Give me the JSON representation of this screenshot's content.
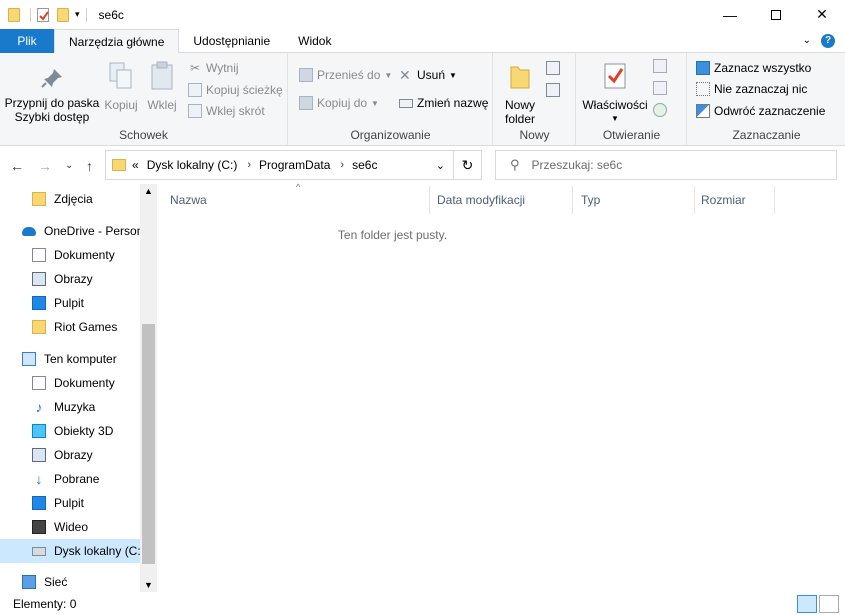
{
  "window": {
    "title": "se6c"
  },
  "tabs": {
    "file": "Plik",
    "home": "Narzędzia główne",
    "share": "Udostępnianie",
    "view": "Widok"
  },
  "ribbon": {
    "clipboard": {
      "label": "Schowek",
      "pin": "Przypnij do paska Szybki dostęp",
      "copy": "Kopiuj",
      "paste": "Wklej",
      "cut": "Wytnij",
      "copy_path": "Kopiuj ścieżkę",
      "paste_shortcut": "Wklej skrót"
    },
    "organize": {
      "label": "Organizowanie",
      "move_to": "Przenieś do",
      "copy_to": "Kopiuj do",
      "delete": "Usuń",
      "rename": "Zmień nazwę"
    },
    "new": {
      "label": "Nowy",
      "new_folder": "Nowy folder"
    },
    "open": {
      "label": "Otwieranie",
      "properties": "Właściwości"
    },
    "select": {
      "label": "Zaznaczanie",
      "select_all": "Zaznacz wszystko",
      "select_none": "Nie zaznaczaj nic",
      "invert": "Odwróć zaznaczenie"
    }
  },
  "address": {
    "prefix": "«",
    "segments": [
      "Dysk lokalny (C:)",
      "ProgramData",
      "se6c"
    ]
  },
  "search": {
    "placeholder": "Przeszukaj: se6c"
  },
  "nav": [
    {
      "label": "Zdjęcia",
      "icon": "folder-icon"
    },
    {
      "label": "OneDrive - Person",
      "icon": "onedrive-icon"
    },
    {
      "label": "Dokumenty",
      "icon": "documents-icon"
    },
    {
      "label": "Obrazy",
      "icon": "pictures-icon"
    },
    {
      "label": "Pulpit",
      "icon": "desktop-icon"
    },
    {
      "label": "Riot Games",
      "icon": "folder-icon"
    },
    {
      "label": "Ten komputer",
      "icon": "computer-icon"
    },
    {
      "label": "Dokumenty",
      "icon": "documents-icon"
    },
    {
      "label": "Muzyka",
      "icon": "music-icon"
    },
    {
      "label": "Obiekty 3D",
      "icon": "objects-3d-icon"
    },
    {
      "label": "Obrazy",
      "icon": "pictures-icon"
    },
    {
      "label": "Pobrane",
      "icon": "downloads-icon"
    },
    {
      "label": "Pulpit",
      "icon": "desktop-icon"
    },
    {
      "label": "Wideo",
      "icon": "video-icon"
    },
    {
      "label": "Dysk lokalny (C:)",
      "icon": "drive-icon"
    },
    {
      "label": "Sieć",
      "icon": "network-icon"
    }
  ],
  "columns": [
    "Nazwa",
    "Data modyfikacji",
    "Typ",
    "Rozmiar"
  ],
  "empty_message": "Ten folder jest pusty.",
  "status": {
    "items": "Elementy: 0"
  }
}
